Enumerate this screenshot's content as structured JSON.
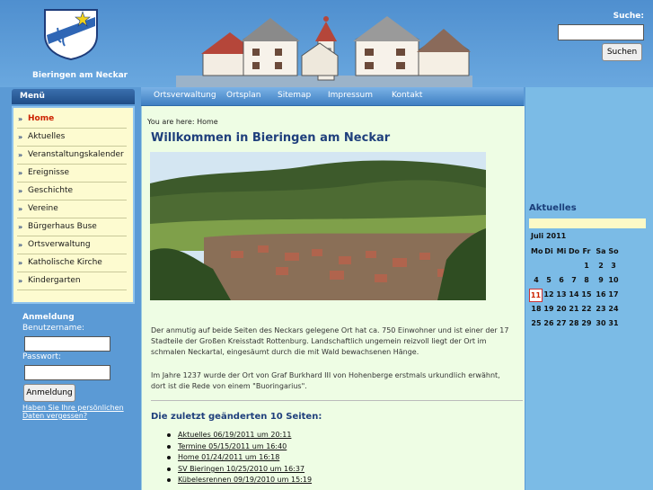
{
  "site": {
    "name": "Bieringen am Neckar"
  },
  "search": {
    "label": "Suche:",
    "placeholder": "",
    "button": "Suchen"
  },
  "topnav": [
    "Ortsverwaltung",
    "Ortsplan",
    "Sitemap",
    "Impressum",
    "Kontakt"
  ],
  "menu": {
    "title": "Menü",
    "items": [
      "Home",
      "Aktuelles",
      "Veranstaltungskalender",
      "Ereignisse",
      "Geschichte",
      "Vereine",
      "Bürgerhaus Buse",
      "Ortsverwaltung",
      "Katholische Kirche",
      "Kindergarten"
    ],
    "active_index": 0
  },
  "login": {
    "title": "Anmeldung",
    "user_label": "Benutzername:",
    "pass_label": "Passwort:",
    "button": "Anmeldung",
    "forgot": "Haben Sie Ihre persönlichen Daten vergessen?"
  },
  "content": {
    "breadcrumb": "You are here: Home",
    "title": "Willkommen in Bieringen am Neckar",
    "para1": "Der anmutig auf beide Seiten des Neckars gelegene Ort hat ca. 750 Einwohner und ist einer der 17 Stadteile der Großen Kreisstadt Rottenburg. Landschaftlich ungemein reizvoll liegt der Ort im schmalen Neckartal, eingesäumt durch die mit Wald bewachsenen Hänge.",
    "para2": "Im Jahre 1237 wurde der Ort von Graf Burkhard III von Hohenberge erstmals urkundlich erwähnt, dort ist die Rede von einem \"Buoringarius\".",
    "changes_title": "Die zuletzt geänderten 10 Seiten:",
    "changes": [
      "Aktuelles 06/19/2011 um 20:11",
      "Termine 05/15/2011 um 16:40",
      "Home 01/24/2011 um 16:18",
      "SV Bieringen 10/25/2010 um 16:37",
      "Kübelesrennen 09/19/2010 um 15:19"
    ]
  },
  "sidebar": {
    "title": "Aktuelles",
    "calendar": {
      "month": "Juli 2011",
      "weekdays": [
        "Mo",
        "Di",
        "Mi",
        "Do",
        "Fr",
        "Sa",
        "So"
      ],
      "weeks": [
        [
          "",
          "",
          "",
          "",
          "1",
          "2",
          "3"
        ],
        [
          "4",
          "5",
          "6",
          "7",
          "8",
          "9",
          "10"
        ],
        [
          "11",
          "12",
          "13",
          "14",
          "15",
          "16",
          "17"
        ],
        [
          "18",
          "19",
          "20",
          "21",
          "22",
          "23",
          "24"
        ],
        [
          "25",
          "26",
          "27",
          "28",
          "29",
          "30",
          "31"
        ]
      ],
      "today": "11"
    }
  }
}
